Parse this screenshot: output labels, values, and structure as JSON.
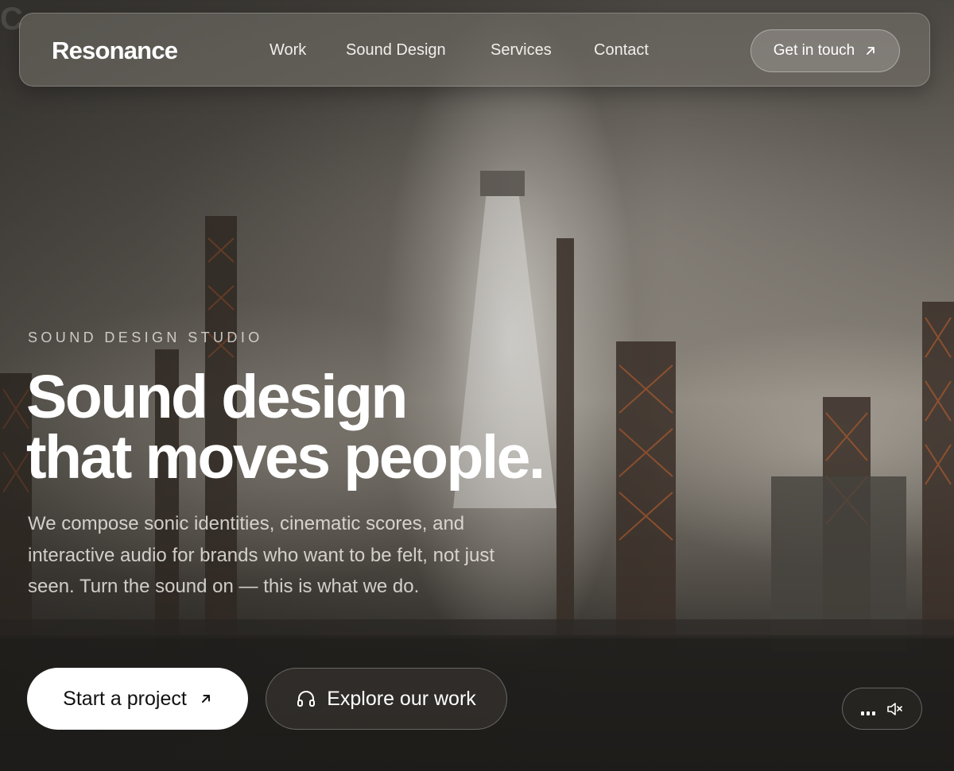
{
  "background_text": "C",
  "nav": {
    "brand": "Resonance",
    "links": [
      {
        "label": "Work"
      },
      {
        "label": "Sound Design"
      },
      {
        "label": "Services"
      },
      {
        "label": "Contact"
      }
    ],
    "cta_label": "Get in touch",
    "cta_icon": "arrow-up-right-icon"
  },
  "hero": {
    "eyebrow": "SOUND DESIGN STUDIO",
    "headline_line1": "Sound design",
    "headline_line2": "that moves people.",
    "subcopy": "We compose sonic identities, cinematic scores, and interactive audio for brands who want to be felt, not just seen. Turn the sound on — this is what we do."
  },
  "actions": {
    "primary_label": "Start a project",
    "primary_icon": "arrow-up-right-icon",
    "secondary_label": "Explore our work",
    "secondary_icon": "headphones-icon"
  },
  "audio_toggle": {
    "icons": [
      "equalizer-icon",
      "speaker-muted-icon"
    ],
    "state": "muted"
  },
  "colors": {
    "text": "#ffffff",
    "primary_button_bg": "#ffffff",
    "primary_button_text": "#111111"
  }
}
